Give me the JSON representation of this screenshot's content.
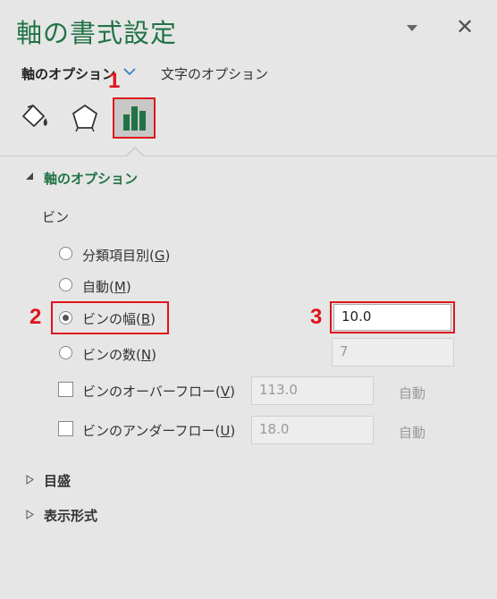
{
  "header": {
    "title": "軸の書式設定",
    "close_glyph": "✕"
  },
  "tabs": {
    "axis_options": "軸のオプション",
    "text_options": "文字のオプション"
  },
  "steps": {
    "one": "1",
    "two": "2",
    "three": "3"
  },
  "sections": {
    "axis_options": "軸のオプション",
    "tick_marks": "目盛",
    "display_format": "表示形式"
  },
  "bins": {
    "heading": "ビン",
    "by_category": {
      "label": "分類項目別(",
      "key": "G",
      "close": ")"
    },
    "automatic": {
      "label": "自動(",
      "key": "M",
      "close": ")"
    },
    "bin_width": {
      "label": "ビンの幅(",
      "key": "B",
      "close": ")",
      "value": "10.0",
      "checked": true
    },
    "num_bins": {
      "label": "ビンの数(",
      "key": "N",
      "close": ")",
      "value": "7"
    },
    "overflow": {
      "label": "ビンのオーバーフロー(",
      "key": "V",
      "close": ")",
      "value": "113.0",
      "auto": "自動"
    },
    "underflow": {
      "label": "ビンのアンダーフロー(",
      "key": "U",
      "close": ")",
      "value": "18.0",
      "auto": "自動"
    }
  },
  "icons": [
    "fill-line-icon",
    "effects-icon",
    "axis-options-icon"
  ],
  "colors": {
    "accent": "#217346",
    "highlight": "#e0141d",
    "background": "#e6e6e6"
  }
}
